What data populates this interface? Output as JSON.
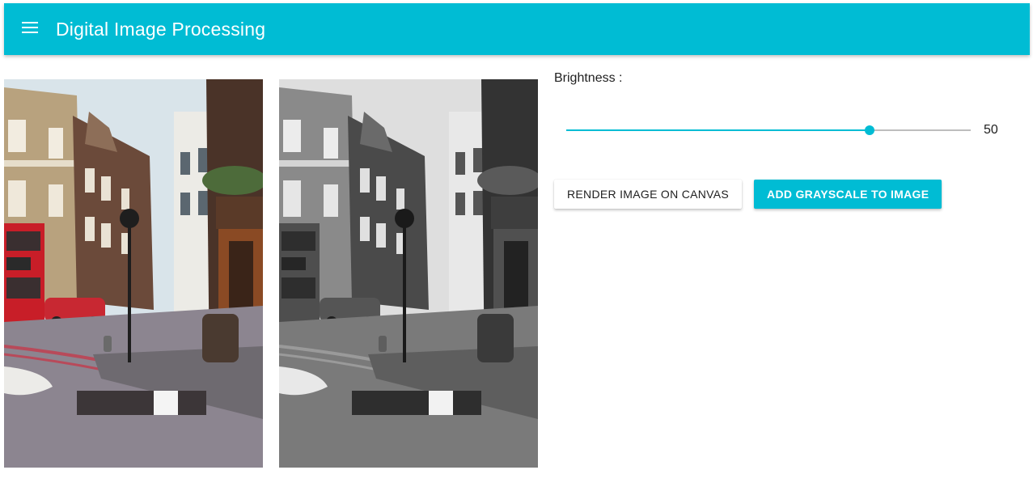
{
  "app": {
    "title": "Digital Image Processing",
    "menu_icon": "menu-icon",
    "accent_color": "#00bcd4"
  },
  "images": {
    "original": {
      "name": "original-street-photo",
      "style": "color"
    },
    "grayscale": {
      "name": "grayscale-street-photo",
      "style": "grayscale"
    }
  },
  "controls": {
    "brightness_label": "Brightness :",
    "brightness_value": "50",
    "slider_fraction": 0.75,
    "render_button": "Render image on canvas",
    "grayscale_button": "Add grayscale to image"
  }
}
